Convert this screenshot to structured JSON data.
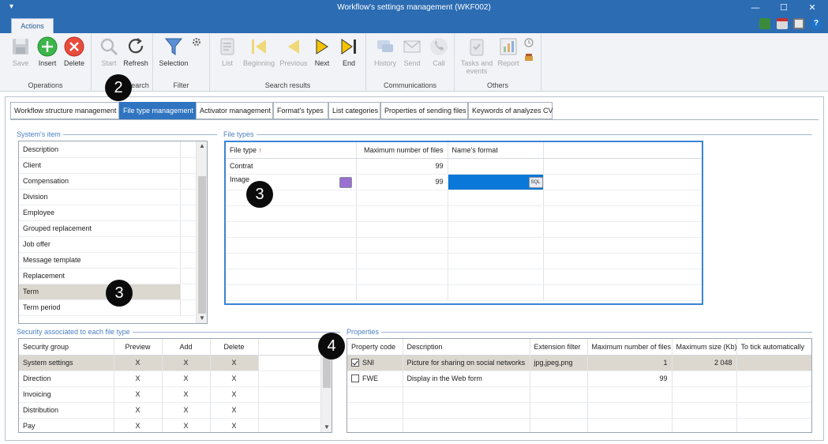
{
  "window": {
    "title": "Workflow's settings management (WKF002)"
  },
  "ribbon": {
    "tab": "Actions",
    "groups": [
      {
        "label": "Operations",
        "buttons": [
          "Save",
          "Insert",
          "Delete"
        ]
      },
      {
        "label": "Search",
        "buttons": [
          "Start",
          "Refresh"
        ]
      },
      {
        "label": "Filter",
        "buttons": [
          "Selection"
        ]
      },
      {
        "label": "Search results",
        "buttons": [
          "List",
          "Beginning",
          "Previous",
          "Next",
          "End"
        ]
      },
      {
        "label": "Communications",
        "buttons": [
          "History",
          "Send",
          "Call"
        ]
      },
      {
        "label": "Others",
        "buttons": [
          "Tasks and events",
          "Report"
        ]
      }
    ]
  },
  "tabs": [
    "Workflow structure management",
    "File type management",
    "Activator management",
    "Format's types",
    "List categories",
    "Properties of sending files",
    "Keywords of analyzes CV"
  ],
  "systems_item": {
    "title": "System's item",
    "items": [
      "Description",
      "Client",
      "Compensation",
      "Division",
      "Employee",
      "Grouped replacement",
      "Job offer",
      "Message template",
      "Replacement",
      "Term",
      "Term period"
    ],
    "selected_index": 9
  },
  "file_types": {
    "title": "File types",
    "columns": [
      "File type",
      "Maximum number of files",
      "Name's format"
    ],
    "sort_glyph": "↑",
    "rows": [
      {
        "type": "Contrat",
        "max": "99",
        "format": ""
      },
      {
        "type": "Image",
        "max": "99",
        "format": ""
      }
    ]
  },
  "security": {
    "title": "Security associated to each file type",
    "columns": [
      "Security group",
      "Preview",
      "Add",
      "Delete"
    ],
    "rows": [
      {
        "group": "System settings",
        "preview": "X",
        "add": "X",
        "delete": "X"
      },
      {
        "group": "Direction",
        "preview": "X",
        "add": "X",
        "delete": "X"
      },
      {
        "group": "Invoicing",
        "preview": "X",
        "add": "X",
        "delete": "X"
      },
      {
        "group": "Distribution",
        "preview": "X",
        "add": "X",
        "delete": "X"
      },
      {
        "group": "Pay",
        "preview": "X",
        "add": "X",
        "delete": "X"
      }
    ]
  },
  "properties": {
    "title": "Properties",
    "columns": [
      "Property code",
      "Description",
      "Extension filter",
      "Maximum number of files",
      "Maximum size (Kb)",
      "To tick automatically"
    ],
    "rows": [
      {
        "code": "SNI",
        "checked": true,
        "description": "Picture for sharing on social networks",
        "ext": "jpg,jpeg,png",
        "max": "1",
        "size": "2 048",
        "auto": ""
      },
      {
        "code": "FWE",
        "checked": false,
        "description": "Display in the Web form",
        "ext": "",
        "max": "99",
        "size": "",
        "auto": ""
      }
    ]
  },
  "badges": {
    "b2": "2",
    "b3": "3",
    "b4": "4"
  },
  "icons": {
    "celllink": "chat-icon",
    "sql": "sql-icon",
    "sql_label": "SQL"
  }
}
